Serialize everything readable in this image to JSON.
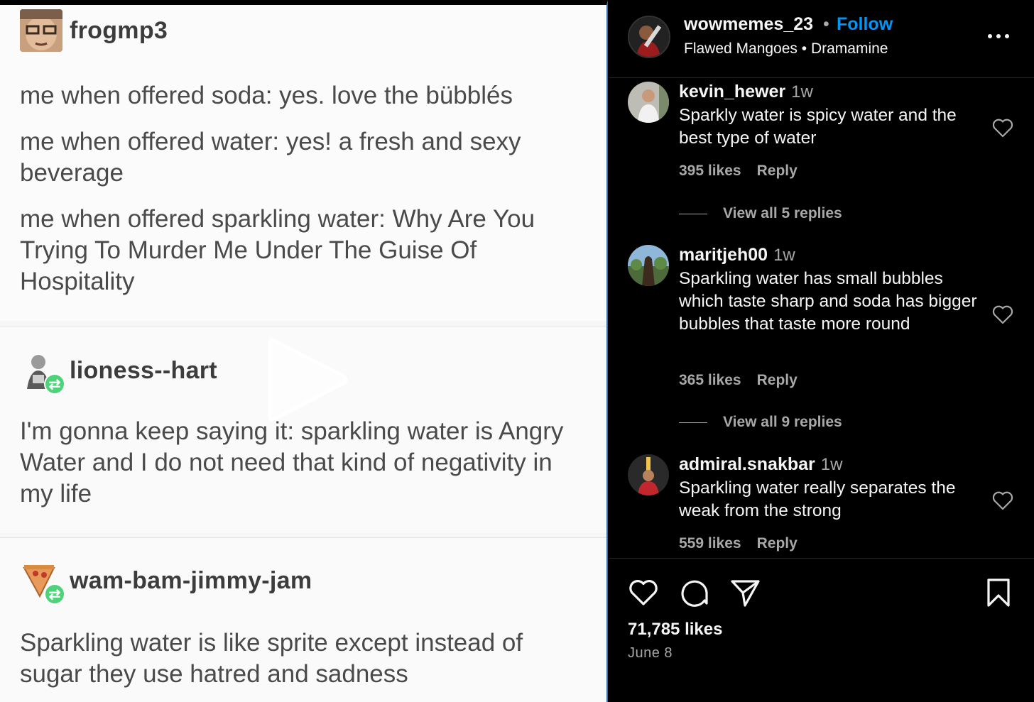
{
  "media": {
    "posts": [
      {
        "username": "frogmp3",
        "lines": [
          "me when offered soda: yes. love the bübblés",
          "me when offered water: yes! a fresh and sexy beverage",
          "me when offered sparkling water: Why Are You Trying To Murder Me Under The Guise Of Hospitality"
        ]
      },
      {
        "username": "lioness--hart",
        "lines": [
          "I'm gonna keep saying it: sparkling water is Angry Water and I do not need that kind of negativity in my life"
        ]
      },
      {
        "username": "wam-bam-jimmy-jam",
        "lines": [
          "Sparkling water is like sprite except instead of sugar they use hatred and sadness"
        ]
      }
    ]
  },
  "header": {
    "username": "wowmemes_23",
    "separator": "•",
    "follow_label": "Follow",
    "audio": "Flawed Mangoes • Dramamine"
  },
  "comments": [
    {
      "username": "kevin_hewer",
      "time": "1w",
      "text": "Sparkly water is spicy water and the best type of water",
      "likes": "395 likes",
      "reply_label": "Reply",
      "view_replies": "View all 5 replies"
    },
    {
      "username": "maritjeh00",
      "time": "1w",
      "text": "Sparkling water has small bubbles which taste sharp and soda has bigger bubbles that taste more round",
      "likes": "365 likes",
      "reply_label": "Reply",
      "view_replies": "View all 9 replies"
    },
    {
      "username": "admiral.snakbar",
      "time": "1w",
      "text": "Sparkling water really separates the weak from the strong",
      "likes": "559 likes",
      "reply_label": "Reply"
    }
  ],
  "footer": {
    "likes": "71,785 likes",
    "date": "June 8"
  },
  "icons": {
    "like": "heart-icon",
    "comment": "comment-icon",
    "share": "share-icon",
    "save": "bookmark-icon",
    "more": "more-icon",
    "play": "play-icon"
  },
  "colors": {
    "accent": "#0095f6",
    "background": "#000000",
    "secondary_text": "#a8a8a8"
  }
}
